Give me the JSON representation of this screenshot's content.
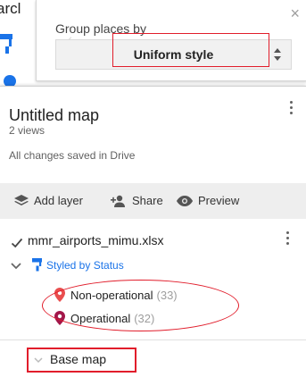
{
  "background": {
    "partial_text": "arcl"
  },
  "group_popup": {
    "title": "Group places by",
    "selected_value": "Uniform style",
    "close_glyph": "×"
  },
  "map": {
    "title": "Untitled map",
    "views": "2 views",
    "save_status": "All changes saved in Drive"
  },
  "toolbar": {
    "add_layer": "Add layer",
    "share": "Share",
    "preview": "Preview"
  },
  "layer": {
    "name": "mmr_airports_mimu.xlsx",
    "styled_by": "Styled by Status",
    "legend": [
      {
        "label": "Non-operational",
        "count": "(33)",
        "color": "#e94e4e"
      },
      {
        "label": "Operational",
        "count": "(32)",
        "color": "#a3174a"
      }
    ]
  },
  "base_map": {
    "label": "Base map"
  },
  "colors": {
    "annotation": "#e11d2b",
    "link": "#1a73e8",
    "toolbar_bg": "#eeeeee"
  }
}
